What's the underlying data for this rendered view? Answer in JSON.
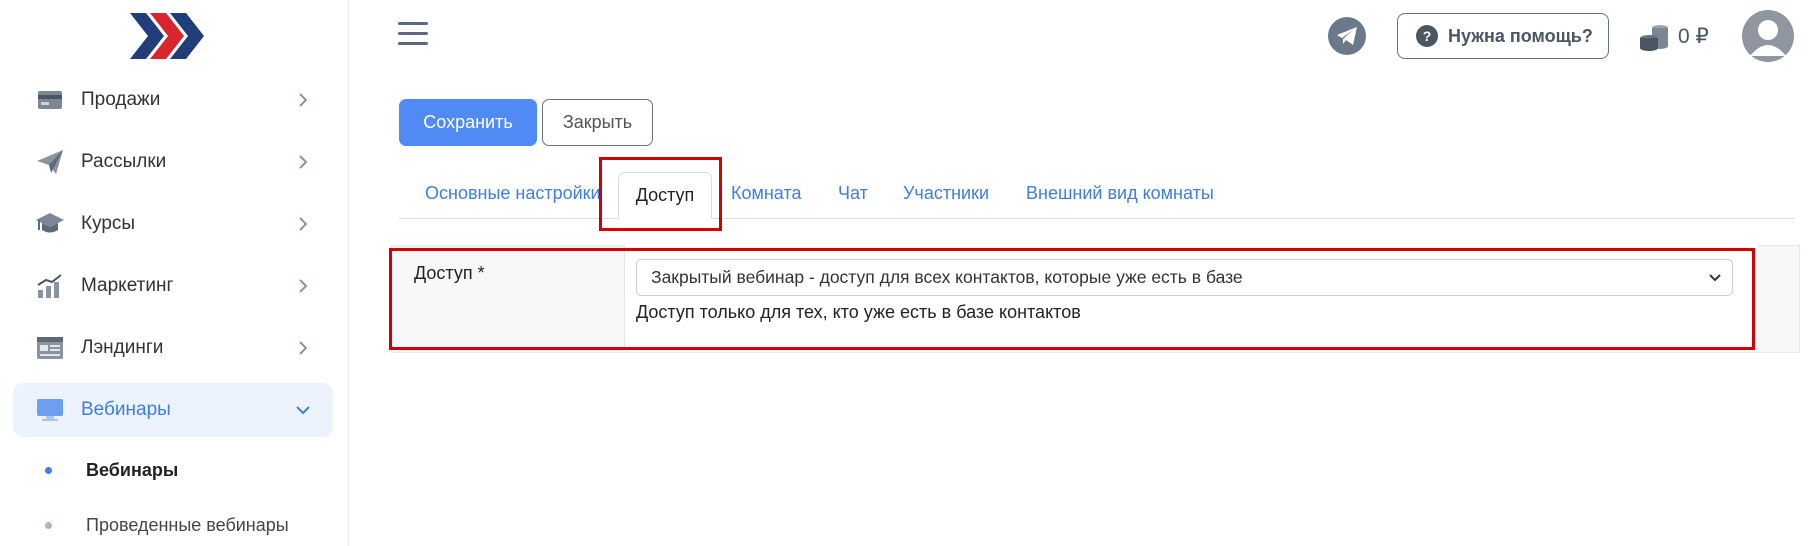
{
  "sidebar": {
    "items": [
      {
        "label": "Продажи",
        "icon": "card-icon"
      },
      {
        "label": "Рассылки",
        "icon": "paper-plane-icon"
      },
      {
        "label": "Курсы",
        "icon": "graduation-cap-icon"
      },
      {
        "label": "Маркетинг",
        "icon": "chart-growth-icon"
      },
      {
        "label": "Лэндинги",
        "icon": "landing-page-icon"
      },
      {
        "label": "Вебинары",
        "icon": "monitor-icon"
      }
    ],
    "subitems": [
      {
        "label": "Вебинары"
      },
      {
        "label": "Проведенные вебинары"
      }
    ]
  },
  "header": {
    "help_label": "Нужна помощь?",
    "balance": "0 ₽"
  },
  "actions": {
    "save_label": "Сохранить",
    "close_label": "Закрыть"
  },
  "tabs": [
    {
      "label": "Основные настройки"
    },
    {
      "label": "Доступ"
    },
    {
      "label": "Комната"
    },
    {
      "label": "Чат"
    },
    {
      "label": "Участники"
    },
    {
      "label": "Внешний вид комнаты"
    }
  ],
  "form": {
    "access_label": "Доступ *",
    "access_value": "Закрытый вебинар - доступ для всех контактов, которые уже есть в базе",
    "access_help": "Доступ только для тех, кто уже есть в базе контактов"
  },
  "colors": {
    "accent": "#4f8af5",
    "link": "#3f7de0",
    "highlight": "#d40000",
    "active_bg": "#edf3fd"
  }
}
